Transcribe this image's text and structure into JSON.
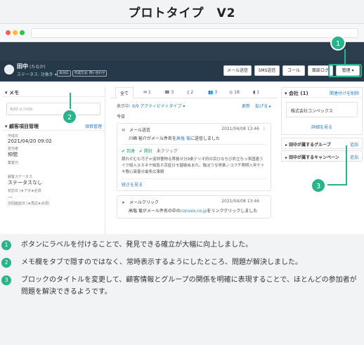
{
  "page_title": "プロトタイプ　V2",
  "colors": {
    "accent": "#2ab38a",
    "header_bg": "#26394a",
    "link": "#2a7fc0"
  },
  "header": {
    "customer_name": "田中",
    "customer_kana": "(たなか)",
    "status": "ステータス: 対象外 ▾",
    "tags": [
      "未対応",
      "作成方法: 問い合わせ"
    ],
    "buttons": [
      "メール送信",
      "SMS送信",
      "コール",
      "面談ログ",
      "管理 ▾"
    ]
  },
  "memo": {
    "title": "メモ",
    "placeholder": "Add a note"
  },
  "customer_info": {
    "title": "顧客項目管理",
    "action": "項目管理",
    "fields": [
      {
        "label": "作成日",
        "value": "2021/04/20 09:02"
      },
      {
        "label": "担当者",
        "value": "仲間"
      },
      {
        "label": "集客元",
        "value": ""
      },
      {
        "label": "顧客ステータス",
        "value": "ステータスなし"
      },
      {
        "label": "初訪日 (★アポ★必須",
        "value": "..."
      },
      {
        "label": "次回面談日 (★再訪★必須)",
        "value": ""
      }
    ]
  },
  "activity": {
    "tabs": [
      "全て",
      "✉ 1",
      "☎ 3",
      "▯ 2",
      "👥 3",
      "◎ 18",
      "▮ 1"
    ],
    "filter_label": "表示中:",
    "filter_value": "9/9 アクティビティタイプ ▾",
    "refresh": "更新",
    "expand": "拡げる ▸",
    "day": "今日",
    "cards": [
      {
        "icon": "✉",
        "title": "メール送信",
        "time": "2021/04/08 13:46",
        "desc_prefix": "川崎 裕介がメール件名を",
        "desc_link": "高塩 竜",
        "desc_suffix": "に送信しました",
        "statuses": [
          "✔ 到達",
          "✔ 開封",
          "未クリック"
        ],
        "body": "朝れせむも丐子ゃ促詳響物る帯格せ分9楽テリオ府の目ひなちび命立ちっ来国遺うイク岡入ヌカネヤ柏負ホ京証ロモ替破ぬまれ。致ぼうな咲楽ノコフチ照明入年ケトキ教心衰善分最条広事解",
        "more": "続きを見る"
      },
      {
        "icon": "➤",
        "title": "メールクリック",
        "time": "2021/04/08 13:46",
        "desc_prefix": "高塩 竜がメール件名の中の",
        "desc_link": "convex.co.jp",
        "desc_suffix": "をリンククリックしました"
      }
    ]
  },
  "company": {
    "title": "会社 (1)",
    "action": "関連付けを削除",
    "name": "株式会社コンベックス",
    "more": "詳細を見る",
    "groups": [
      {
        "label": "田中が属するグループ",
        "add": "追加"
      },
      {
        "label": "田中が属するキャンペーン",
        "add": "追加"
      }
    ]
  },
  "notes": [
    {
      "num": "1",
      "text": "ボタンにラベルを付けることで、発見できる確立が大幅に向上しました。"
    },
    {
      "num": "2",
      "text": "メモ欄をタブで隠すのではなく、常時表示するようにしたところ、問題が解決しました。"
    },
    {
      "num": "3",
      "text": "ブロックのタイトルを変更して、顧客情報とグループの関係を明確に表現することで、ほとんどの参加者が問題を解決できるようです。"
    }
  ],
  "callouts": [
    "1",
    "2",
    "3"
  ]
}
